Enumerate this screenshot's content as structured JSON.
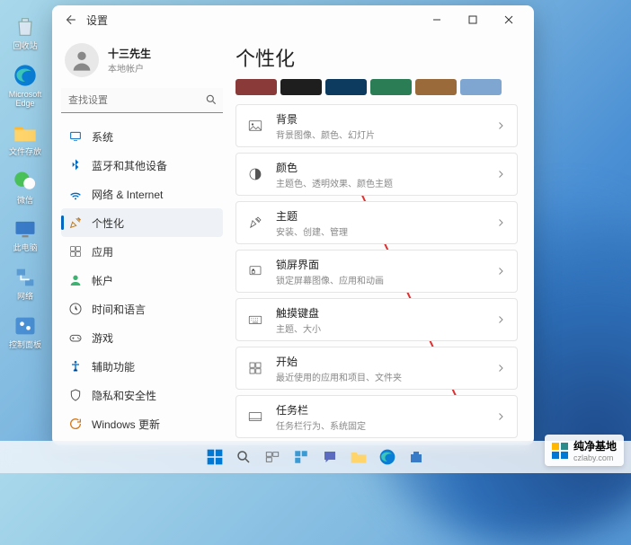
{
  "desktop": {
    "icons": [
      {
        "name": "recycle-bin",
        "label": "回收站"
      },
      {
        "name": "edge",
        "label": "Microsoft Edge"
      },
      {
        "name": "folder",
        "label": "文件存放"
      },
      {
        "name": "wechat",
        "label": "微信"
      },
      {
        "name": "this-pc",
        "label": "此电脑"
      },
      {
        "name": "network",
        "label": "网络"
      },
      {
        "name": "control-panel",
        "label": "控制面板"
      }
    ]
  },
  "window": {
    "title": "设置",
    "user": {
      "name": "十三先生",
      "sub": "本地帐户"
    },
    "search_placeholder": "查找设置",
    "nav": [
      {
        "id": "system",
        "label": "系统"
      },
      {
        "id": "bluetooth",
        "label": "蓝牙和其他设备"
      },
      {
        "id": "network",
        "label": "网络 & Internet"
      },
      {
        "id": "personalization",
        "label": "个性化",
        "active": true
      },
      {
        "id": "apps",
        "label": "应用"
      },
      {
        "id": "accounts",
        "label": "帐户"
      },
      {
        "id": "time",
        "label": "时间和语言"
      },
      {
        "id": "gaming",
        "label": "游戏"
      },
      {
        "id": "accessibility",
        "label": "辅助功能"
      },
      {
        "id": "privacy",
        "label": "隐私和安全性"
      },
      {
        "id": "update",
        "label": "Windows 更新"
      }
    ],
    "page_title": "个性化",
    "theme_colors": [
      "#8b3a3a",
      "#1e1e1e",
      "#0d3a5f",
      "#2a7d55",
      "#9a6a3a",
      "#7fa6d0"
    ],
    "cards": [
      {
        "id": "background",
        "title": "背景",
        "sub": "背景图像、颜色、幻灯片"
      },
      {
        "id": "colors",
        "title": "颜色",
        "sub": "主题色、透明效果、颜色主题"
      },
      {
        "id": "themes",
        "title": "主题",
        "sub": "安装、创建、管理"
      },
      {
        "id": "lockscreen",
        "title": "锁屏界面",
        "sub": "锁定屏幕图像、应用和动画"
      },
      {
        "id": "touch-keyboard",
        "title": "触摸键盘",
        "sub": "主题、大小"
      },
      {
        "id": "start",
        "title": "开始",
        "sub": "最近使用的应用和项目、文件夹"
      },
      {
        "id": "taskbar",
        "title": "任务栏",
        "sub": "任务栏行为、系统固定"
      }
    ]
  },
  "watermark": {
    "brand": "纯净基地",
    "url": "czlaby.com"
  }
}
